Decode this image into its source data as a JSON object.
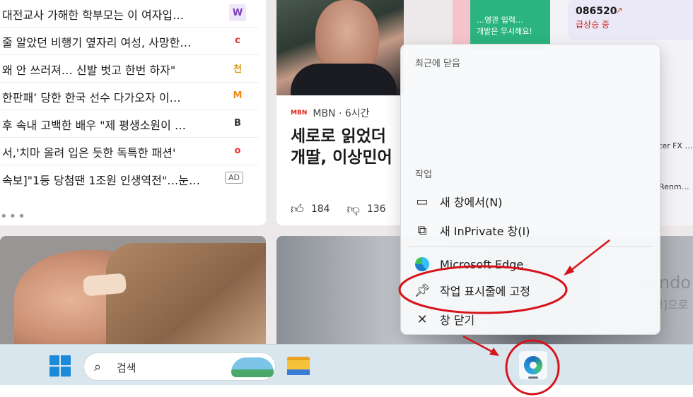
{
  "news_list": {
    "items": [
      {
        "title": "대전교사 가해한 학부모는 이 여자입…",
        "logo": "W",
        "logo_color": "#7b3fb8"
      },
      {
        "title": "줄 알았던 비행기 옆자리 여성, 사망한…",
        "logo": "c",
        "logo_color": "#e0312e"
      },
      {
        "title": "왜 안 쓰러져… 신발 벗고 한번 하자\"",
        "logo": "천",
        "logo_color": "#d49a1a"
      },
      {
        "title": "한판패’ 당한 한국 선수 다가오자 이…",
        "logo": "M",
        "logo_color": "#f08a17"
      },
      {
        "title": "후 속내 고백한 배우 \"제 평생소원이 …",
        "logo": "B",
        "logo_color": "#333333"
      },
      {
        "title": "서,'치마 올려 입은 듯한 독특한 패션'",
        "logo": "o",
        "logo_color": "#e0312e"
      },
      {
        "title": "속보]\"1등 당첨땐 1조원 인생역전\"…눈…",
        "ad": "AD"
      }
    ],
    "more": "•••"
  },
  "article": {
    "source_logo": "MBN",
    "source": "MBN · 6시간",
    "headline_line1": "세로로 읽었더",
    "headline_line2": "개딸, 이상민어",
    "likes": "184",
    "dislikes": "136"
  },
  "promo": {
    "line1": "…영관 입력…",
    "line2": "개발은 무시해요!"
  },
  "stock": {
    "code": "086520",
    "trend": "급상승 중"
  },
  "side_labels": {
    "fx": "ter FX …",
    "ren": "Renm…"
  },
  "watermark": {
    "line1": "Windo",
    "line2": "[설정]으로"
  },
  "jumplist": {
    "recent_heading": "최근에 닫음",
    "tasks_heading": "작업",
    "new_window": "새 창에서(N)",
    "new_inprivate": "새 InPrivate 창(I)",
    "app_name": "Microsoft Edge",
    "pin_taskbar": "작업 표시줄에 고정",
    "close_window": "창 닫기"
  },
  "taskbar": {
    "search_placeholder": "검색"
  },
  "colors": {
    "annotation_red": "#d6131b",
    "taskbar_bg": "#d9e6ee",
    "accent_blue": "#1b8ad8"
  }
}
